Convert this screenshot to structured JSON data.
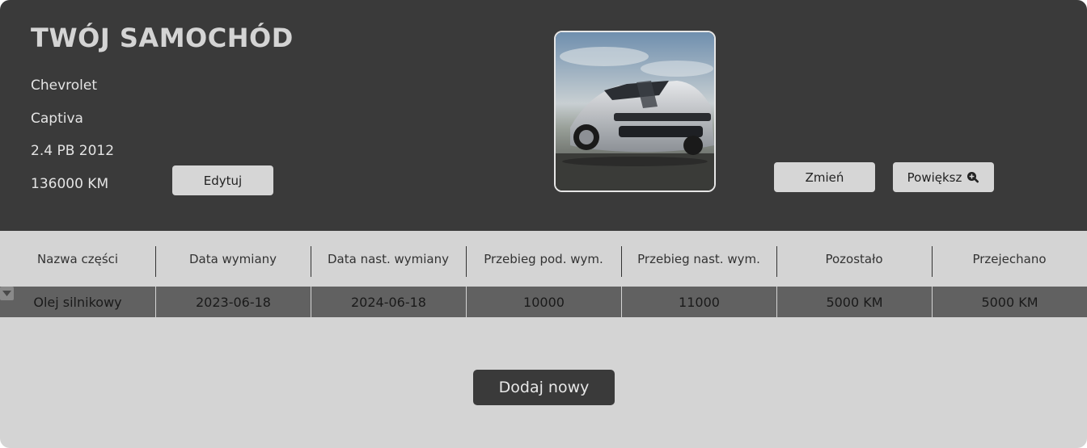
{
  "car": {
    "section_title": "TWÓJ SAMOCHÓD",
    "make": "Chevrolet",
    "model": "Captiva",
    "engine": "2.4 PB 2012",
    "mileage": "136000 KM",
    "edit_label": "Edytuj",
    "change_label": "Zmień",
    "zoom_label": "Powiększ"
  },
  "table": {
    "headers": [
      "Nazwa części",
      "Data wymiany",
      "Data nast. wymiany",
      "Przebieg pod. wym.",
      "Przebieg nast. wym.",
      "Pozostało",
      "Przejechano"
    ],
    "rows": [
      [
        "Olej silnikowy",
        "2023-06-18",
        "2024-06-18",
        "10000",
        "11000",
        "5000 KM",
        "5000 KM"
      ]
    ]
  },
  "actions": {
    "add_new_label": "Dodaj nowy"
  },
  "colors": {
    "header_bg": "#3a3a3a",
    "body_bg": "#d4d4d4",
    "row_bg": "#616161"
  },
  "icons": {
    "zoom": "zoom-in-icon",
    "expander": "caret-down-icon"
  }
}
